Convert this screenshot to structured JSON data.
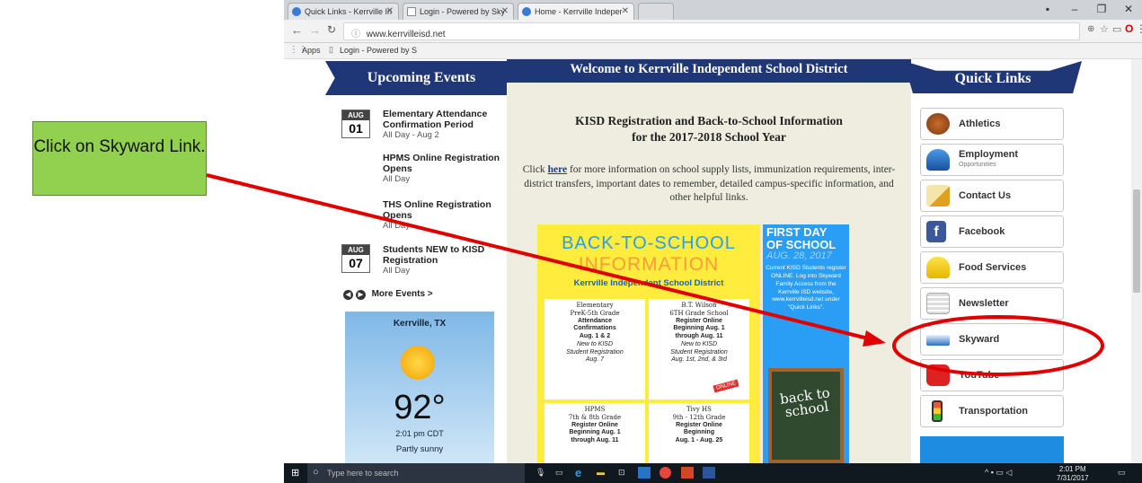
{
  "browser": {
    "tabs": [
      "Quick Links - Kerrville In",
      "Login - Powered by Sky",
      "Home - Kerrville Indeper"
    ],
    "url": "www.kerrvilleisd.net",
    "bookmarks": {
      "apps": "Apps",
      "login": "Login - Powered by S"
    }
  },
  "events": {
    "title": "Upcoming Events",
    "items": [
      {
        "month": "AUG",
        "day": "01",
        "title": "Elementary Attendance Confirmation Period",
        "when": "All Day - Aug 2"
      },
      {
        "title": "HPMS Online Registration Opens",
        "when": "All Day"
      },
      {
        "title": "THS Online Registration Opens",
        "when": "All Day"
      },
      {
        "month": "AUG",
        "day": "07",
        "title": "Students NEW to KISD Registration",
        "when": "All Day"
      }
    ],
    "more": "More Events >"
  },
  "weather": {
    "city": "Kerrville, TX",
    "temp": "92°",
    "time": "2:01 pm CDT",
    "cond": "Partly sunny"
  },
  "welcome": {
    "title": "Welcome to Kerrville Independent School District",
    "heading1": "KISD Registration and Back-to-School Information",
    "heading2": "for the 2017-2018 School Year",
    "body_pre": "Click",
    "body_link": "here",
    "body_post": "for more information on school supply lists, immunization requirements, inter-district transfers, important dates to remember, detailed campus-specific information, and other helpful links."
  },
  "flyer": {
    "title1": "BACK-TO-SCHOOL",
    "title2": "INFORMATION",
    "district": "Kerrville Independent School District",
    "b1": [
      "Elementary",
      "PreK-5th Grade",
      "Attendance",
      "Confirmations",
      "Aug. 1 & 2",
      "New to KISD",
      "Student Registration",
      "Aug. 7"
    ],
    "b2": [
      "B.T. Wilson",
      "6TH Grade School",
      "Register Online",
      "Beginning Aug. 1",
      "through Aug. 11",
      "New to KISD",
      "Student Registration",
      "Aug. 1st, 2nd, & 3rd"
    ],
    "b3": [
      "HPMS",
      "7th & 8th Grade",
      "Register Online",
      "Beginning Aug. 1",
      "through Aug. 11"
    ],
    "b4": [
      "Tivy HS",
      "9th - 12th Grade",
      "Register Online",
      "Beginning",
      "Aug. 1 - Aug. 25"
    ],
    "online": "ONLINE",
    "first1": "FIRST DAY",
    "first2": "OF SCHOOL",
    "first_date": "AUG. 28, 2017",
    "first_body": "Current KISD Students register ONLINE. Log into Skyward Family Access from the Kerrville ISD website, www.kerrvilleisd.net under \"Quick Links\".",
    "chalk": "back to school"
  },
  "quicklinks": {
    "title": "Quick Links",
    "items": [
      {
        "label": "Athletics",
        "sub": ""
      },
      {
        "label": "Employment",
        "sub": "Opportunities"
      },
      {
        "label": "Contact Us",
        "sub": ""
      },
      {
        "label": "Facebook",
        "sub": ""
      },
      {
        "label": "Food Services",
        "sub": ""
      },
      {
        "label": "Newsletter",
        "sub": ""
      },
      {
        "label": "Skyward",
        "sub": ""
      },
      {
        "label": "YouTube",
        "sub": ""
      },
      {
        "label": "Transportation",
        "sub": ""
      }
    ]
  },
  "taskbar": {
    "search": "Type here to search",
    "time": "2:01 PM",
    "date": "7/31/2017"
  },
  "annotation": {
    "callout": "Click on Skyward Link."
  },
  "colors": {
    "banner": "#1f3677",
    "callout": "#92d050",
    "arrow": "#e00000",
    "flyer_yellow": "#ffec3d",
    "flyer_blue": "#2a9df4"
  }
}
